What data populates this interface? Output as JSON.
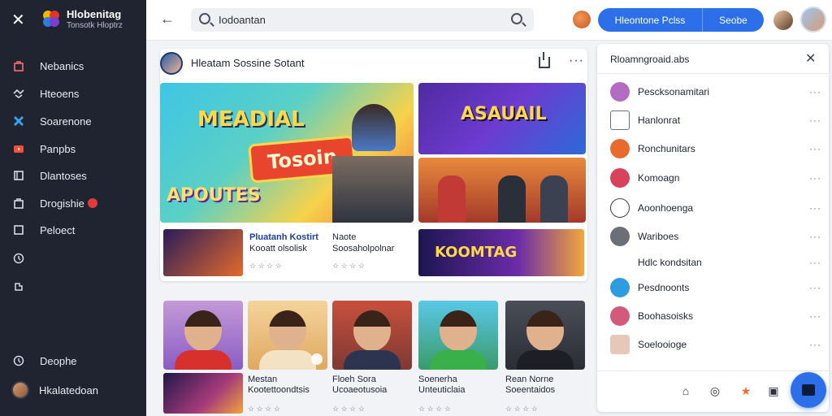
{
  "sidebar": {
    "brand_title": "Hlobenitag",
    "brand_subtitle": "Tonsotk Hloptrz",
    "items": [
      {
        "label": "Nebanics",
        "icon": "bag-icon"
      },
      {
        "label": "Hteoens",
        "icon": "handshake-icon"
      },
      {
        "label": "Soarenone",
        "icon": "tools-icon"
      },
      {
        "label": "Panpbs",
        "icon": "video-icon"
      },
      {
        "label": "Dlantoses",
        "icon": "film-icon"
      },
      {
        "label": "Drogishie",
        "icon": "bag-icon",
        "badge": true
      },
      {
        "label": "Peloect",
        "icon": "file-icon"
      },
      {
        "label": "",
        "icon": "clock-icon"
      },
      {
        "label": "",
        "icon": "puzzle-icon"
      }
    ],
    "bottom_item": "Deophe",
    "user_name": "Hkalatedoan"
  },
  "topbar": {
    "search_value": "Iodoantan",
    "primary_btn": "Hleontone Pclss",
    "secondary_btn": "Seobe"
  },
  "post": {
    "title": "Hleatam Sossine Sotant",
    "main_thumb_title": "MEADIAL",
    "main_thumb_banner": "Tosoin",
    "main_thumb_subtitle": "APOUTES",
    "top_right_title": "ASAUAIL",
    "wide_thumb_title": "KOOMTAG",
    "sub1_line1": "Pluatanh Kostirt",
    "sub1_line2": "Kooatt olsolisk",
    "sub1_meta": "☆ ☆ ☆ ☆",
    "sub2_line1": "Naote",
    "sub2_line2": "Soosaholpolnar",
    "sub2_meta": "☆ ☆ ☆ ☆"
  },
  "grid": [
    {
      "line1": "Mestan",
      "line2": "Kootettoondtsis",
      "meta": "☆ ☆ ☆ ☆"
    },
    {
      "line1": "Floeh Sora",
      "line2": "Ucoaeotusoia",
      "meta": "☆ ☆ ☆ ☆"
    },
    {
      "line1": "Soenerha",
      "line2": "Unteuticlaia",
      "meta": "☆ ☆ ☆ ☆"
    },
    {
      "line1": "Rean Norne",
      "line2": "Soeentaidos",
      "meta": "☆ ☆ ☆ ☆"
    }
  ],
  "panel": {
    "title": "Rloamngroaid.abs",
    "items": [
      {
        "label": "Pescksonamitari",
        "icon_color": "#b36cc4"
      },
      {
        "label": "Hanlonrat",
        "icon_color": "#ffffff"
      },
      {
        "label": "Ronchunitars",
        "icon_color": "#e86a2c"
      },
      {
        "label": "Komoagn",
        "icon_color": "#d8425a"
      },
      {
        "label": "Aoonhoenga",
        "icon_color": "#ffffff"
      },
      {
        "label": "Wariboes",
        "icon_color": "#6b6f78"
      },
      {
        "label": "Hdlc kondsitan",
        "icon_color": "transparent"
      },
      {
        "label": "Pesdnoonts",
        "icon_color": "#2d9ce0"
      },
      {
        "label": "Boohasoisks",
        "icon_color": "#d45a7c"
      },
      {
        "label": "Soelooioge",
        "icon_color": "#e7c8b8"
      }
    ]
  }
}
